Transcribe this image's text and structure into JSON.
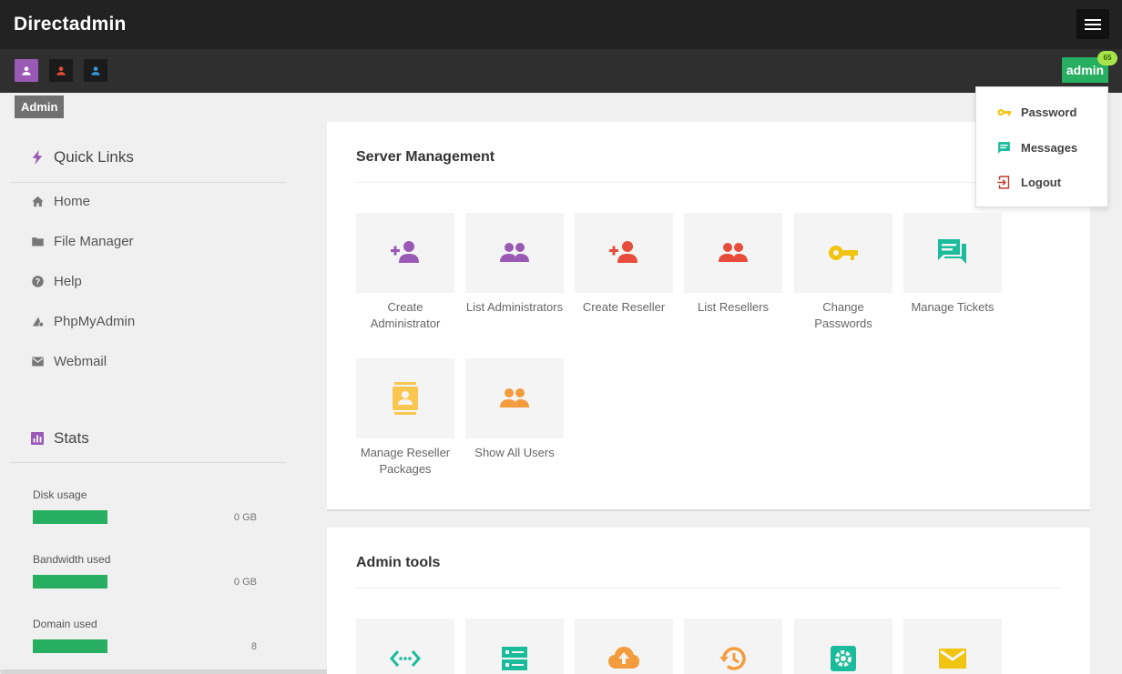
{
  "app": {
    "title": "Directadmin"
  },
  "roles": [
    {
      "name": "admin",
      "color": "#9b59b6"
    },
    {
      "name": "reseller",
      "color": "#e74c3c"
    },
    {
      "name": "user",
      "color": "#3498db"
    }
  ],
  "level_tag": "Admin",
  "user_menu": {
    "username": "admin",
    "badge": "65",
    "items": [
      {
        "label": "Password",
        "icon": "key-icon",
        "color": "#f1c40f"
      },
      {
        "label": "Messages",
        "icon": "message-icon",
        "color": "#1abc9c"
      },
      {
        "label": "Logout",
        "icon": "logout-icon",
        "color": "#c0392b"
      }
    ]
  },
  "sidebar": {
    "quick_links_title": "Quick Links",
    "links": [
      {
        "label": "Home",
        "icon": "home-icon"
      },
      {
        "label": "File Manager",
        "icon": "folder-icon"
      },
      {
        "label": "Help",
        "icon": "help-icon"
      },
      {
        "label": "PhpMyAdmin",
        "icon": "database-icon"
      },
      {
        "label": "Webmail",
        "icon": "mail-icon"
      }
    ],
    "stats_title": "Stats",
    "stats": [
      {
        "label": "Disk usage",
        "value": "0 GB",
        "fill": 1.0
      },
      {
        "label": "Bandwidth used",
        "value": "0 GB",
        "fill": 1.0
      },
      {
        "label": "Domain used",
        "value": "8",
        "fill": 1.0
      }
    ]
  },
  "server_management": {
    "title": "Server Management",
    "tiles": [
      {
        "label": "Create Administrator",
        "icon": "add-user-icon",
        "color": "#9b59b6"
      },
      {
        "label": "List Administrators",
        "icon": "users-icon",
        "color": "#9b59b6"
      },
      {
        "label": "Create Reseller",
        "icon": "add-user-icon",
        "color": "#e74c3c"
      },
      {
        "label": "List Resellers",
        "icon": "users-icon",
        "color": "#e74c3c"
      },
      {
        "label": "Change Passwords",
        "icon": "key-icon",
        "color": "#f1c40f"
      },
      {
        "label": "Manage Tickets",
        "icon": "chat-icon",
        "color": "#1abc9c"
      },
      {
        "label": "Manage Reseller Packages",
        "icon": "contact-card-icon",
        "color": "#f9c74f"
      },
      {
        "label": "Show All Users",
        "icon": "users-icon",
        "color": "#f39c3d"
      }
    ]
  },
  "admin_tools": {
    "title": "Admin tools",
    "tiles": [
      {
        "icon": "code-arrows-icon",
        "color": "#1abc9c"
      },
      {
        "icon": "server-icon",
        "color": "#1abc9c"
      },
      {
        "icon": "cloud-upload-icon",
        "color": "#f39c3d"
      },
      {
        "icon": "restore-icon",
        "color": "#f39c3d"
      },
      {
        "icon": "gear-icon",
        "color": "#1abc9c"
      },
      {
        "icon": "envelope-icon",
        "color": "#f1c40f"
      }
    ]
  }
}
